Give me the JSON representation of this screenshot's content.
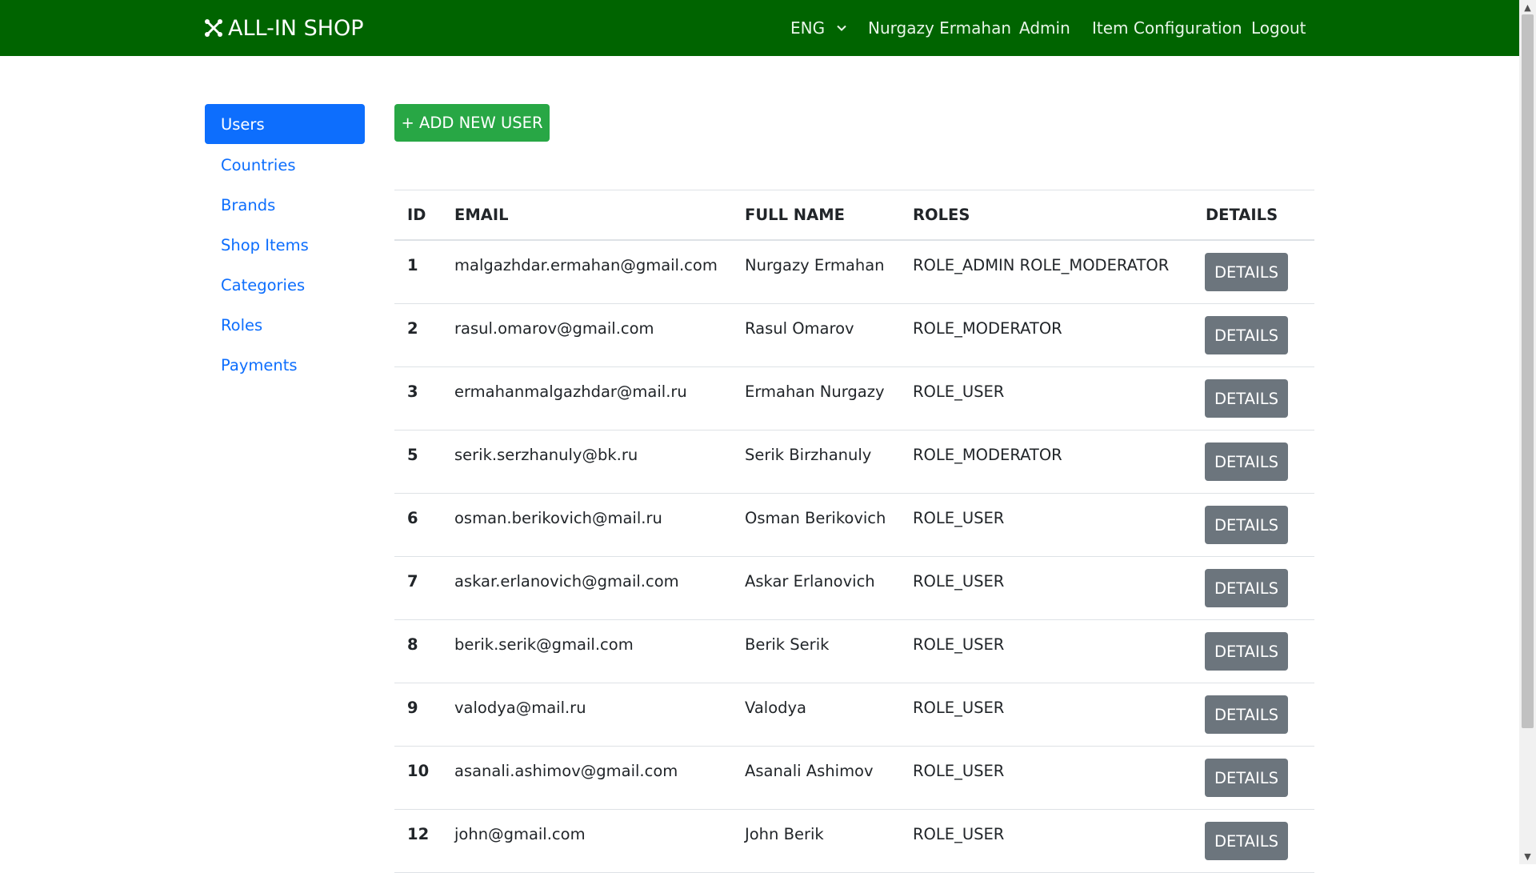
{
  "navbar": {
    "brand": "ALL-IN SHOP",
    "brand_icon": "joomla-like-logo-icon",
    "language": "ENG",
    "user_name": "Nurgazy Ermahan",
    "admin": "Admin",
    "item_configuration": "Item Configuration",
    "logout": "Logout",
    "color": "#006400"
  },
  "sidebar": {
    "items": [
      {
        "label": "Users",
        "active": true
      },
      {
        "label": "Countries"
      },
      {
        "label": "Brands"
      },
      {
        "label": "Shop Items"
      },
      {
        "label": "Categories"
      },
      {
        "label": "Roles"
      },
      {
        "label": "Payments"
      }
    ],
    "active_color": "#0d6efd"
  },
  "actions": {
    "add_user": "+ ADD NEW USER",
    "add_color": "#28a745"
  },
  "table": {
    "headers": [
      "ID",
      "EMAIL",
      "FULL NAME",
      "ROLES",
      "DETAILS"
    ],
    "details_label": "DETAILS",
    "rows": [
      {
        "id": "1",
        "email": "malgazhdar.ermahan@gmail.com",
        "full_name": "Nurgazy Ermahan",
        "roles": "ROLE_ADMIN ROLE_MODERATOR"
      },
      {
        "id": "2",
        "email": "rasul.omarov@gmail.com",
        "full_name": "Rasul Omarov",
        "roles": "ROLE_MODERATOR"
      },
      {
        "id": "3",
        "email": "ermahanmalgazhdar@mail.ru",
        "full_name": "Ermahan Nurgazy",
        "roles": "ROLE_USER"
      },
      {
        "id": "5",
        "email": "serik.serzhanuly@bk.ru",
        "full_name": "Serik Birzhanuly",
        "roles": "ROLE_MODERATOR"
      },
      {
        "id": "6",
        "email": "osman.berikovich@mail.ru",
        "full_name": "Osman Berikovich",
        "roles": "ROLE_USER"
      },
      {
        "id": "7",
        "email": "askar.erlanovich@gmail.com",
        "full_name": "Askar Erlanovich",
        "roles": "ROLE_USER"
      },
      {
        "id": "8",
        "email": "berik.serik@gmail.com",
        "full_name": "Berik Serik",
        "roles": "ROLE_USER"
      },
      {
        "id": "9",
        "email": "valodya@mail.ru",
        "full_name": "Valodya",
        "roles": "ROLE_USER"
      },
      {
        "id": "10",
        "email": "asanali.ashimov@gmail.com",
        "full_name": "Asanali Ashimov",
        "roles": "ROLE_USER"
      },
      {
        "id": "12",
        "email": "john@gmail.com",
        "full_name": "John Berik",
        "roles": "ROLE_USER"
      }
    ],
    "details_color": "#6c757d"
  }
}
